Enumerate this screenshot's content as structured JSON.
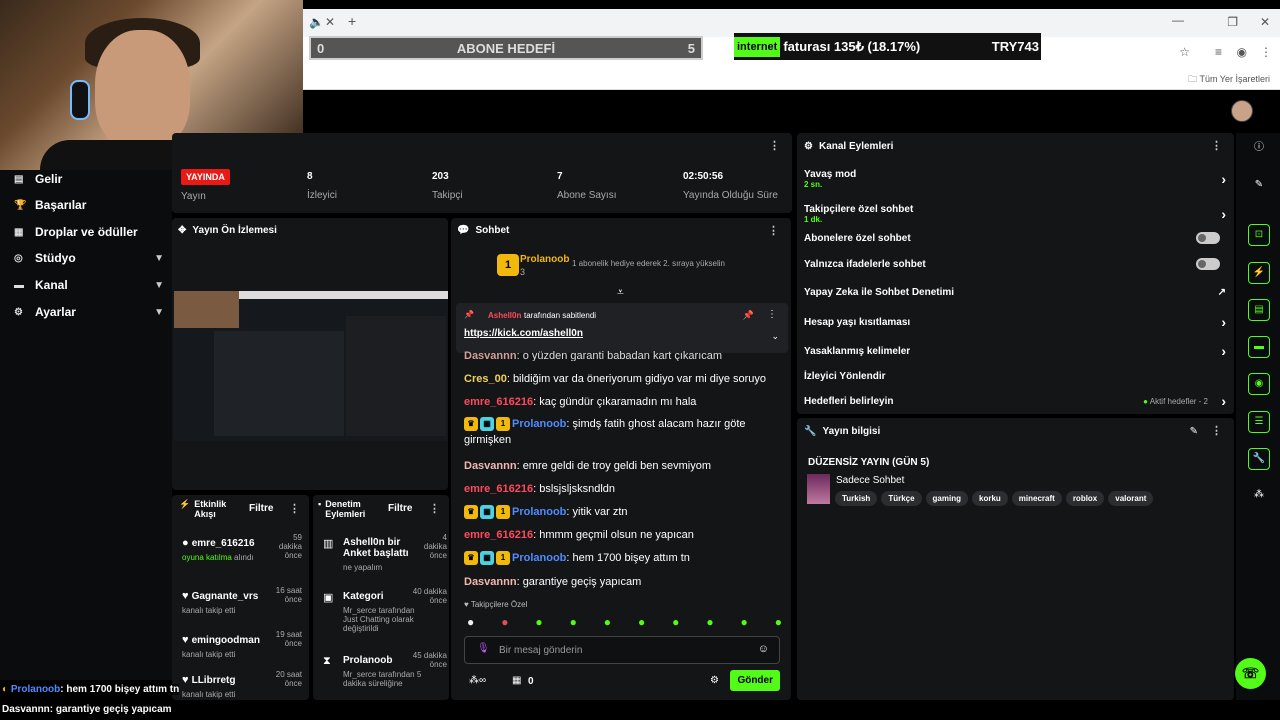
{
  "overlay": {
    "goal": {
      "left": "0",
      "title": "ABONE HEDEFİ",
      "right": "5"
    },
    "ticker": {
      "highlight": "internet",
      "text": "faturası 135₺ (18.17%)",
      "code": "TRY743"
    },
    "bottom1_user": "Prolanoob",
    "bottom1_text": ": hem 1700 bişey attım tn",
    "bottom2_user": "Dasvannn",
    "bottom2_text": ": garantiye geçiş yapıcam"
  },
  "browser": {
    "bookmarks_label": "Tüm Yer İşaretleri"
  },
  "sidebar": {
    "items": [
      {
        "label": "Gelir",
        "icon": "chart-icon"
      },
      {
        "label": "Başarılar",
        "icon": "trophy-icon"
      },
      {
        "label": "Droplar ve ödüller",
        "icon": "gift-icon"
      },
      {
        "label": "Stüdyo",
        "icon": "studio-icon"
      },
      {
        "label": "Kanal",
        "icon": "channel-icon"
      },
      {
        "label": "Ayarlar",
        "icon": "gear-icon"
      }
    ]
  },
  "stats": {
    "live_badge": "YAYINDA",
    "live_label": "Yayın",
    "viewers": "8",
    "viewers_label": "İzleyici",
    "followers": "203",
    "followers_label": "Takipçi",
    "subs": "7",
    "subs_label": "Abone Sayısı",
    "uptime": "02:50:56",
    "uptime_label": "Yayında Olduğu Süre"
  },
  "preview": {
    "title": "Yayın Ön İzlemesi"
  },
  "activity": {
    "title": "Etkinlik Akışı",
    "filter": "Filtre",
    "items": [
      {
        "name": "emre_616216",
        "time": "59 dakika önce",
        "sub_hl": "oyuna katılma",
        "sub": "alındı"
      },
      {
        "name": "Gagnante_vrs",
        "time": "16 saat önce",
        "sub_hl": "",
        "sub": "kanalı takip etti"
      },
      {
        "name": "emingoodman",
        "time": "19 saat önce",
        "sub_hl": "",
        "sub": "kanalı takip etti"
      },
      {
        "name": "LLibrretg",
        "time": "20 saat önce",
        "sub_hl": "",
        "sub": "kanalı takip etti"
      }
    ]
  },
  "moderation": {
    "title": "Denetim Eylemleri",
    "filter": "Filtre",
    "items": [
      {
        "name": "Ashell0n bir Anket başlattı",
        "time": "4 dakika önce",
        "sub": "ne yapalım"
      },
      {
        "name": "Kategori",
        "time": "40 dakika önce",
        "sub": "Mr_serce tarafından Just Chatting olarak değiştirildi"
      },
      {
        "name": "Prolanoob",
        "time": "45 dakika önce",
        "sub": "Mr_serce tarafından 5 dakika süreliğine"
      }
    ]
  },
  "chat": {
    "title": "Sohbet",
    "gifter": {
      "name": "Prolanoob",
      "count": "3",
      "rank": "1",
      "msg": "1 abonelik hediye ederek 2. sıraya yükselin"
    },
    "pinned": {
      "by": "Ashell0n",
      "by_text": "tarafından sabitlendi",
      "link": "https://kick.com/ashell0n"
    },
    "messages": [
      {
        "user": "Dasvannn",
        "color": "#f2b8b0",
        "text": ": o yüzden garanti babadan kart çıkarıcam",
        "badges": false
      },
      {
        "user": "Cres_00",
        "color": "#f0d060",
        "text": ": bildiğim var da öneriyorum gidiyo var mi diye soruyo",
        "badges": false
      },
      {
        "user": "emre_616216",
        "color": "#ff4a5e",
        "text": ": kaç gündür çıkaramadın mı hala",
        "badges": false
      },
      {
        "user": "Prolanoob",
        "color": "#4f8cff",
        "text": ": şimdş fatih ghost alacam hazır göte girmişken",
        "badges": true
      },
      {
        "user": "Dasvannn",
        "color": "#f2b8b0",
        "text": ": emre geldi de troy geldi ben sevmiyom",
        "badges": false
      },
      {
        "user": "emre_616216",
        "color": "#ff4a5e",
        "text": ": bslsjsljsksndldn",
        "badges": false
      },
      {
        "user": "Prolanoob",
        "color": "#4f8cff",
        "text": ": yitik var ztn",
        "badges": true
      },
      {
        "user": "emre_616216",
        "color": "#ff4a5e",
        "text": ": hmmm geçmil olsun ne yapıcan",
        "badges": false
      },
      {
        "user": "Prolanoob",
        "color": "#4f8cff",
        "text": ": hem 1700 bişey attım tn",
        "badges": true
      },
      {
        "user": "Dasvannn",
        "color": "#f2b8b0",
        "text": ": garantiye geçiş yapıcam",
        "badges": false
      }
    ],
    "followers_only": "Takipçilere Özel",
    "input_placeholder": "Bir mesaj gönderin",
    "points": "0",
    "send": "Gönder"
  },
  "actions": {
    "title": "Kanal Eylemleri",
    "rows": [
      {
        "label": "Yavaş mod",
        "value": "2 sn.",
        "ctrl": "arrow"
      },
      {
        "label": "Takipçilere özel sohbet",
        "value": "1 dk.",
        "ctrl": "arrow"
      },
      {
        "label": "Abonelere özel sohbet",
        "value": "",
        "ctrl": "toggle"
      },
      {
        "label": "Yalnızca ifadelerle sohbet",
        "value": "",
        "ctrl": "toggle"
      },
      {
        "label": "Yapay Zeka ile Sohbet Denetimi",
        "value": "",
        "ctrl": "ext"
      },
      {
        "label": "Hesap yaşı kısıtlaması",
        "value": "",
        "ctrl": "arrow"
      },
      {
        "label": "Yasaklanmış kelimeler",
        "value": "",
        "ctrl": "arrow"
      },
      {
        "label": "İzleyici Yönlendir",
        "value": "",
        "ctrl": "none"
      },
      {
        "label": "Hedefleri belirleyin",
        "value": "",
        "ctrl": "arrow"
      }
    ],
    "goals_status": "Aktif hedefler - 2"
  },
  "info": {
    "title": "Yayın bilgisi",
    "stream_title": "DÜZENSİZ YAYIN (GÜN 5)",
    "category": "Sadece Sohbet",
    "tags": [
      "Turkish",
      "Türkçe",
      "gaming",
      "korku",
      "minecraft",
      "roblox",
      "valorant"
    ]
  },
  "colors": {
    "accent": "#53fc18",
    "live": "#e91916",
    "panel": "#141517"
  }
}
